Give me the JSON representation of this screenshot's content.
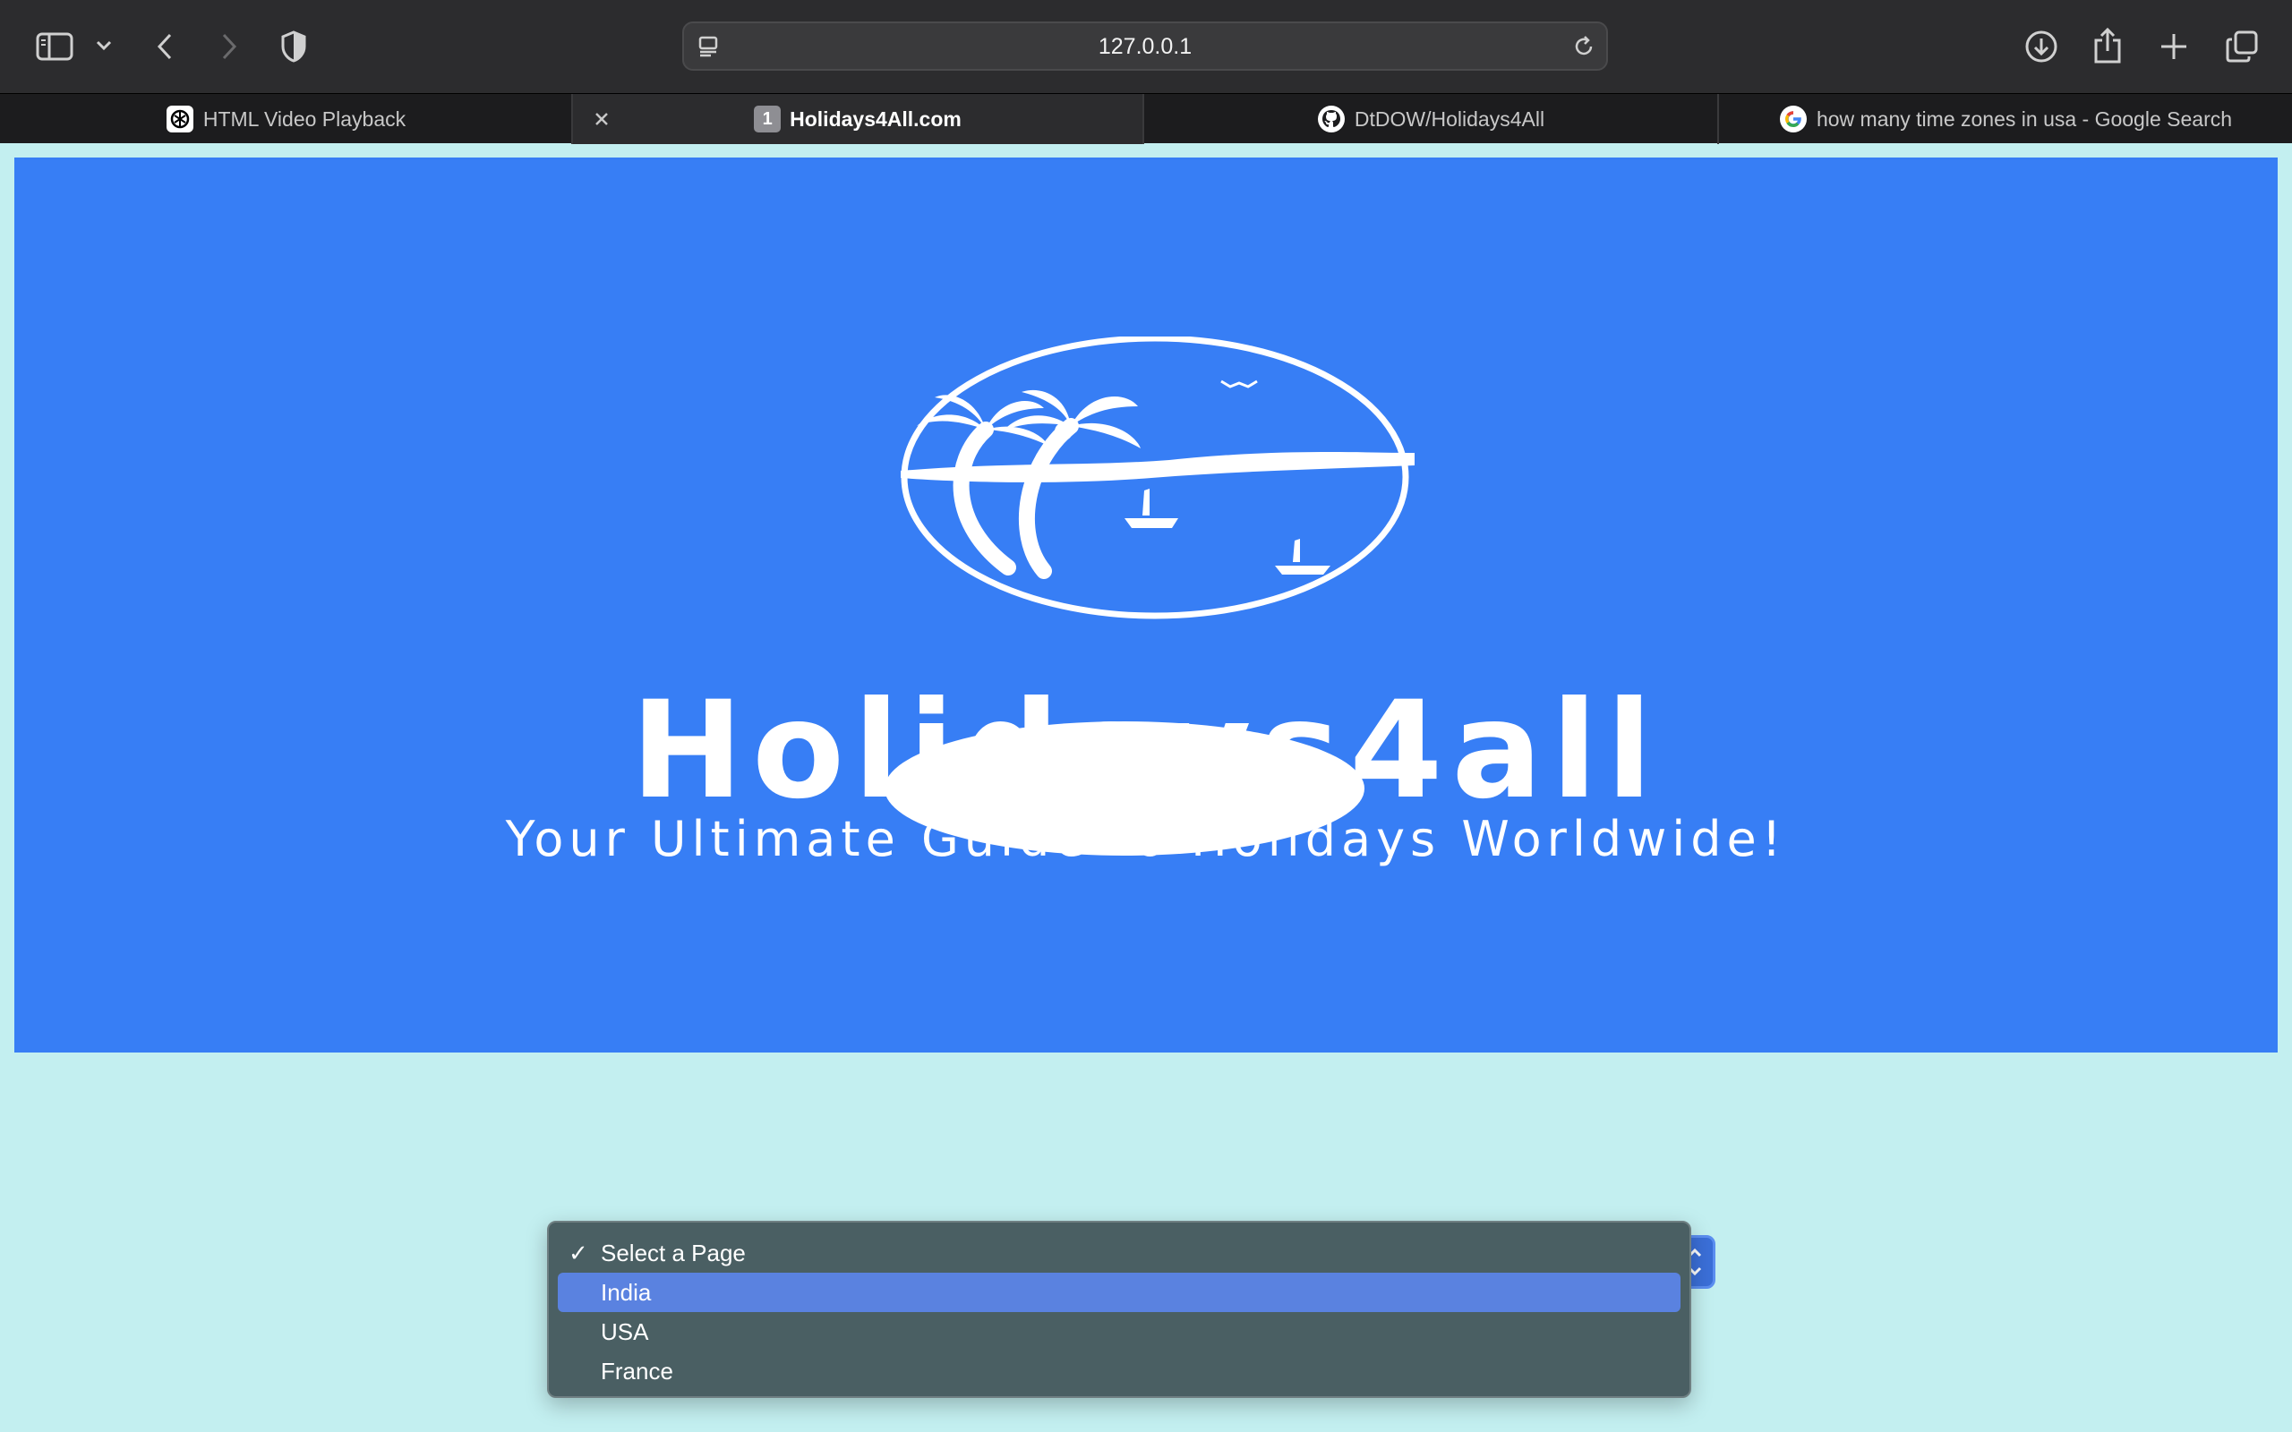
{
  "browser": {
    "url": "127.0.0.1",
    "tabs": [
      {
        "title": "HTML Video Playback",
        "active": false
      },
      {
        "title": "Holidays4All.com",
        "active": true,
        "badge": "1"
      },
      {
        "title": "DtDOW/Holidays4All",
        "active": false
      },
      {
        "title": "how many time zones in usa - Google Search",
        "active": false
      }
    ],
    "icons": [
      "sidebar-icon",
      "chevron-down-icon",
      "back-icon",
      "forward-icon",
      "shield-icon",
      "page-menu-icon",
      "reload-icon",
      "download-icon",
      "share-icon",
      "new-tab-icon",
      "tab-overview-icon",
      "close-icon"
    ]
  },
  "banner": {
    "brand": "Holidays4all",
    "tagline": "Your Ultimate Guide to Holidays Worldwide!",
    "background": "#377ef5"
  },
  "page_select": {
    "selected": "Select a Page",
    "checkmark": "✓",
    "options": [
      "Select a Page",
      "India",
      "USA",
      "France"
    ],
    "highlighted": "India"
  },
  "colors": {
    "page_bg": "#c3eff0",
    "menu_bg": "#4a5f63",
    "menu_highlight": "#5a82e0"
  }
}
